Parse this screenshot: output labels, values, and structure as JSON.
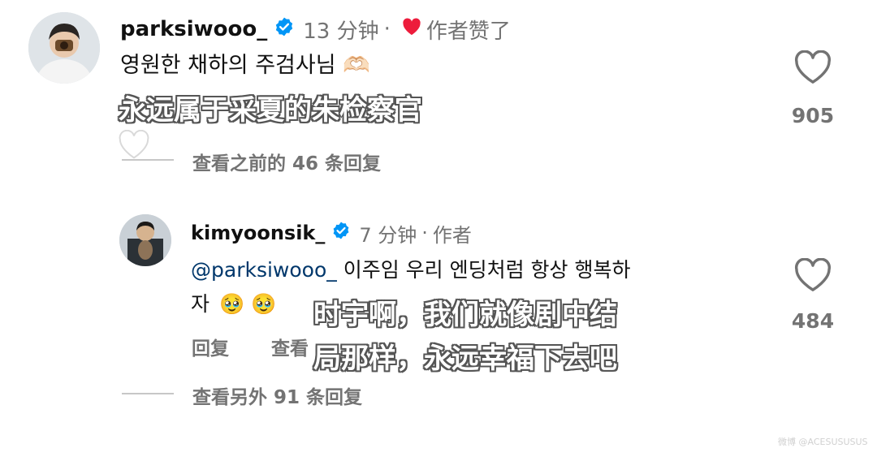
{
  "comment1": {
    "username": "parksiwooo_",
    "time": "13 分钟",
    "separator": "·",
    "author_liked": "作者赞了",
    "text": "영원한 채하의 주검사님",
    "emoji": "🫶🏻",
    "subtitle": "永远属于采夏的朱检察官",
    "like_count": "905",
    "view_previous_replies": "查看之前的 46 条回复"
  },
  "comment2": {
    "username": "kimyoonsik_",
    "time": "7 分钟",
    "separator": "·",
    "author_tag": "作者",
    "mention": "@parksiwooo_",
    "text_line1": " 이주임 우리 엔딩처럼 항상 행복하",
    "text_line2": "자",
    "emoji": "🥹 🥹",
    "subtitle_line1": "时宇啊，我们就像剧中结",
    "subtitle_line2": "局那样，永远幸福下去吧",
    "like_count": "484",
    "reply_label": "回复",
    "see_translation_label": "查看",
    "view_more_replies": "查看另外 91 条回复"
  },
  "icons": {
    "verified": "verified-badge-icon",
    "like": "heart-outline-icon",
    "author_liked": "heart-filled-icon",
    "white_heart": "white-heart-emoji"
  },
  "colors": {
    "verified_blue": "#0095f6",
    "liked_red": "#ed1c3c",
    "mention_blue": "#00376b",
    "meta_gray": "#737373"
  },
  "watermark": "微博 @ACESUSUSUS"
}
